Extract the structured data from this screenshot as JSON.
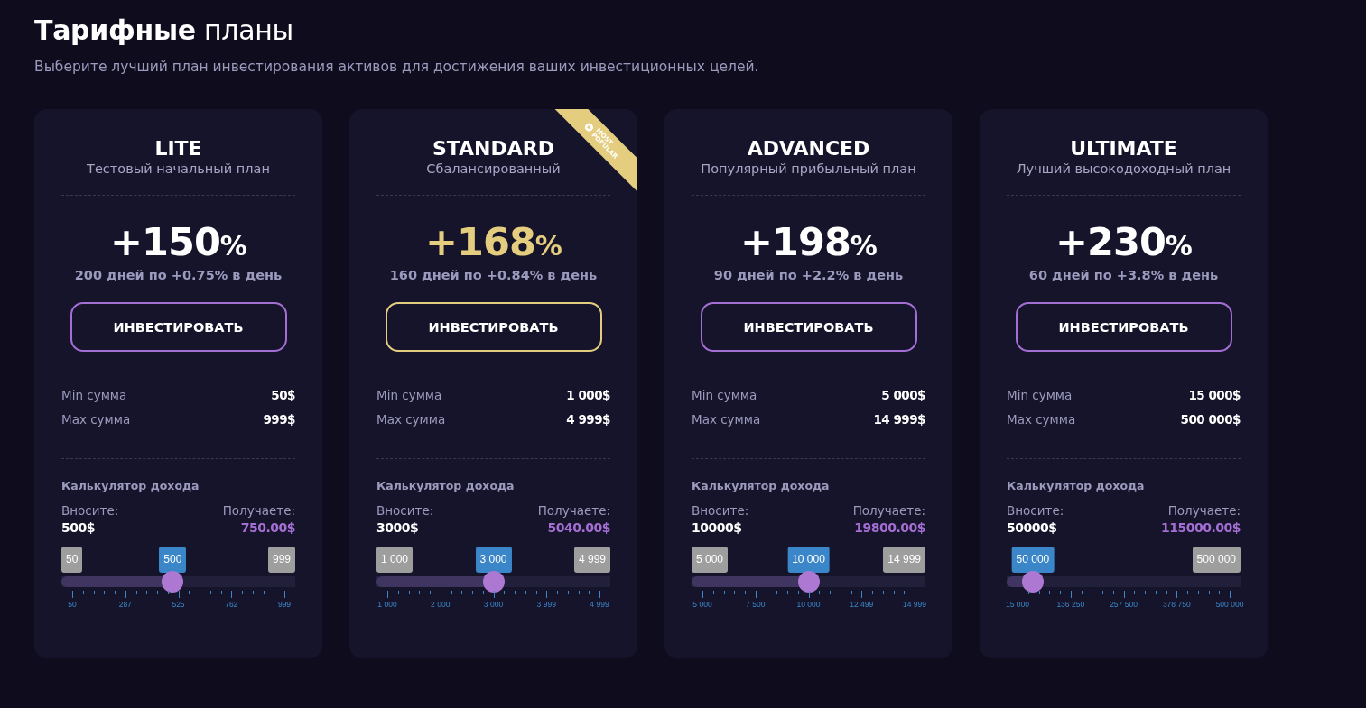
{
  "header": {
    "title": "**Тарифные** планы",
    "subtitle": "Выберите лучший план инвестирования активов для достижения ваших инвестиционных целей."
  },
  "plans": [
    {
      "name": "LITE",
      "description": "Тестовый начальный план",
      "featured": false,
      "return_value": "+150",
      "return_unit": "%",
      "terms": "200 дней по +0.75% в день",
      "button": "ИНВЕСТИРОВАТЬ",
      "limits": [
        {
          "label": "Min сумма",
          "value": "50$"
        },
        {
          "label": "Max сумма",
          "value": "999$"
        }
      ],
      "calculator": {
        "title": "Калькулятор дохода",
        "deposit_label": "Вносите:",
        "deposit": "500$",
        "payout_label": "Получаете:",
        "payout": "750.00$",
        "min_label": "50",
        "value_label": "500",
        "max_label": "999",
        "level": 0.474,
        "scale": [
          "50",
          "287",
          "525",
          "762",
          "999"
        ]
      }
    },
    {
      "name": "STANDARD",
      "description": "Сбалансированный",
      "featured": true,
      "ribbon": "MOST POPULAR",
      "return_value": "+168",
      "return_unit": "%",
      "terms": "160 дней по +0.84% в день",
      "button": "ИНВЕСТИРОВАТЬ",
      "limits": [
        {
          "label": "Min сумма",
          "value": "1 000$"
        },
        {
          "label": "Max сумма",
          "value": "4 999$"
        }
      ],
      "calculator": {
        "title": "Калькулятор дохода",
        "deposit_label": "Вносите:",
        "deposit": "3000$",
        "payout_label": "Получаете:",
        "payout": "5040.00$",
        "min_label": "1 000",
        "value_label": "3 000",
        "max_label": "4 999",
        "level": 0.5,
        "scale": [
          "1 000",
          "2 000",
          "3 000",
          "3 999",
          "4 999"
        ]
      }
    },
    {
      "name": "ADVANCED",
      "description": "Популярный прибыльный план",
      "featured": false,
      "return_value": "+198",
      "return_unit": "%",
      "terms": "90 дней по +2.2% в день",
      "button": "ИНВЕСТИРОВАТЬ",
      "limits": [
        {
          "label": "Min сумма",
          "value": "5 000$"
        },
        {
          "label": "Max сумма",
          "value": "14 999$"
        }
      ],
      "calculator": {
        "title": "Калькулятор дохода",
        "deposit_label": "Вносите:",
        "deposit": "10000$",
        "payout_label": "Получаете:",
        "payout": "19800.00$",
        "min_label": "5 000",
        "value_label": "10 000",
        "max_label": "14 999",
        "level": 0.5,
        "scale": [
          "5 000",
          "7 500",
          "10 000",
          "12 499",
          "14 999"
        ]
      }
    },
    {
      "name": "ULTIMATE",
      "description": "Лучший высокодоходный план",
      "featured": false,
      "return_value": "+230",
      "return_unit": "%",
      "terms": "60 дней по +3.8% в день",
      "button": "ИНВЕСТИРОВАТЬ",
      "limits": [
        {
          "label": "Min сумма",
          "value": "15 000$"
        },
        {
          "label": "Max сумма",
          "value": "500 000$"
        }
      ],
      "calculator": {
        "title": "Калькулятор дохода",
        "deposit_label": "Вносите:",
        "deposit": "50000$",
        "payout_label": "Получаете:",
        "payout": "115000.00$",
        "value_label": "50 000",
        "max_label": "500 000",
        "level": 0.072,
        "scale": [
          "15 000",
          "136 250",
          "257 500",
          "378 750",
          "500 000"
        ]
      }
    }
  ]
}
